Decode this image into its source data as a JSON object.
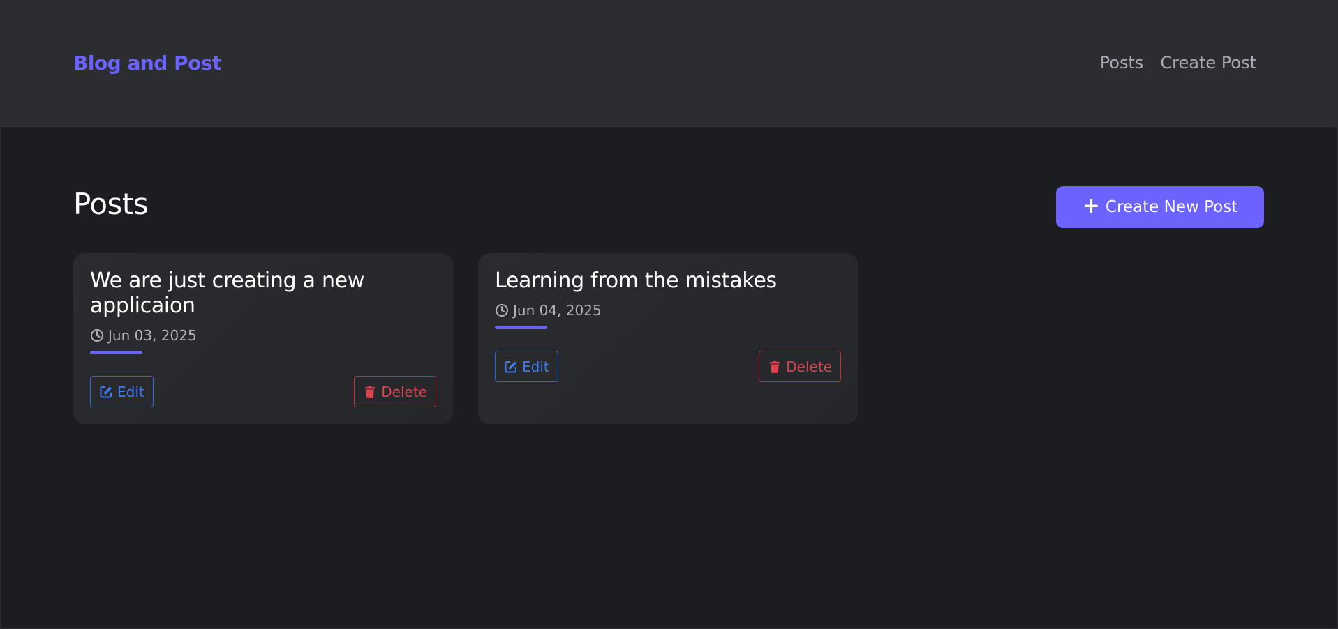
{
  "brand": "Blog and Post",
  "nav": {
    "posts": "Posts",
    "create_post": "Create Post"
  },
  "main": {
    "title": "Posts",
    "create_button": "Create New Post"
  },
  "posts": [
    {
      "title": "We are just creating a new applicaion",
      "date": "Jun 03, 2025",
      "edit_label": "Edit",
      "delete_label": "Delete"
    },
    {
      "title": "Learning from the mistakes",
      "date": "Jun 04, 2025",
      "edit_label": "Edit",
      "delete_label": "Delete"
    }
  ],
  "icons": {
    "create": "plus-icon",
    "date": "clock-icon",
    "edit": "edit-icon",
    "delete": "trash-icon"
  },
  "colors": {
    "accent": "#6c63ff",
    "edit": "#3d7cf0",
    "delete": "#d9424f",
    "background": "#1c1d20",
    "navbar": "#2c2d31",
    "card": "#2a2b2f"
  }
}
